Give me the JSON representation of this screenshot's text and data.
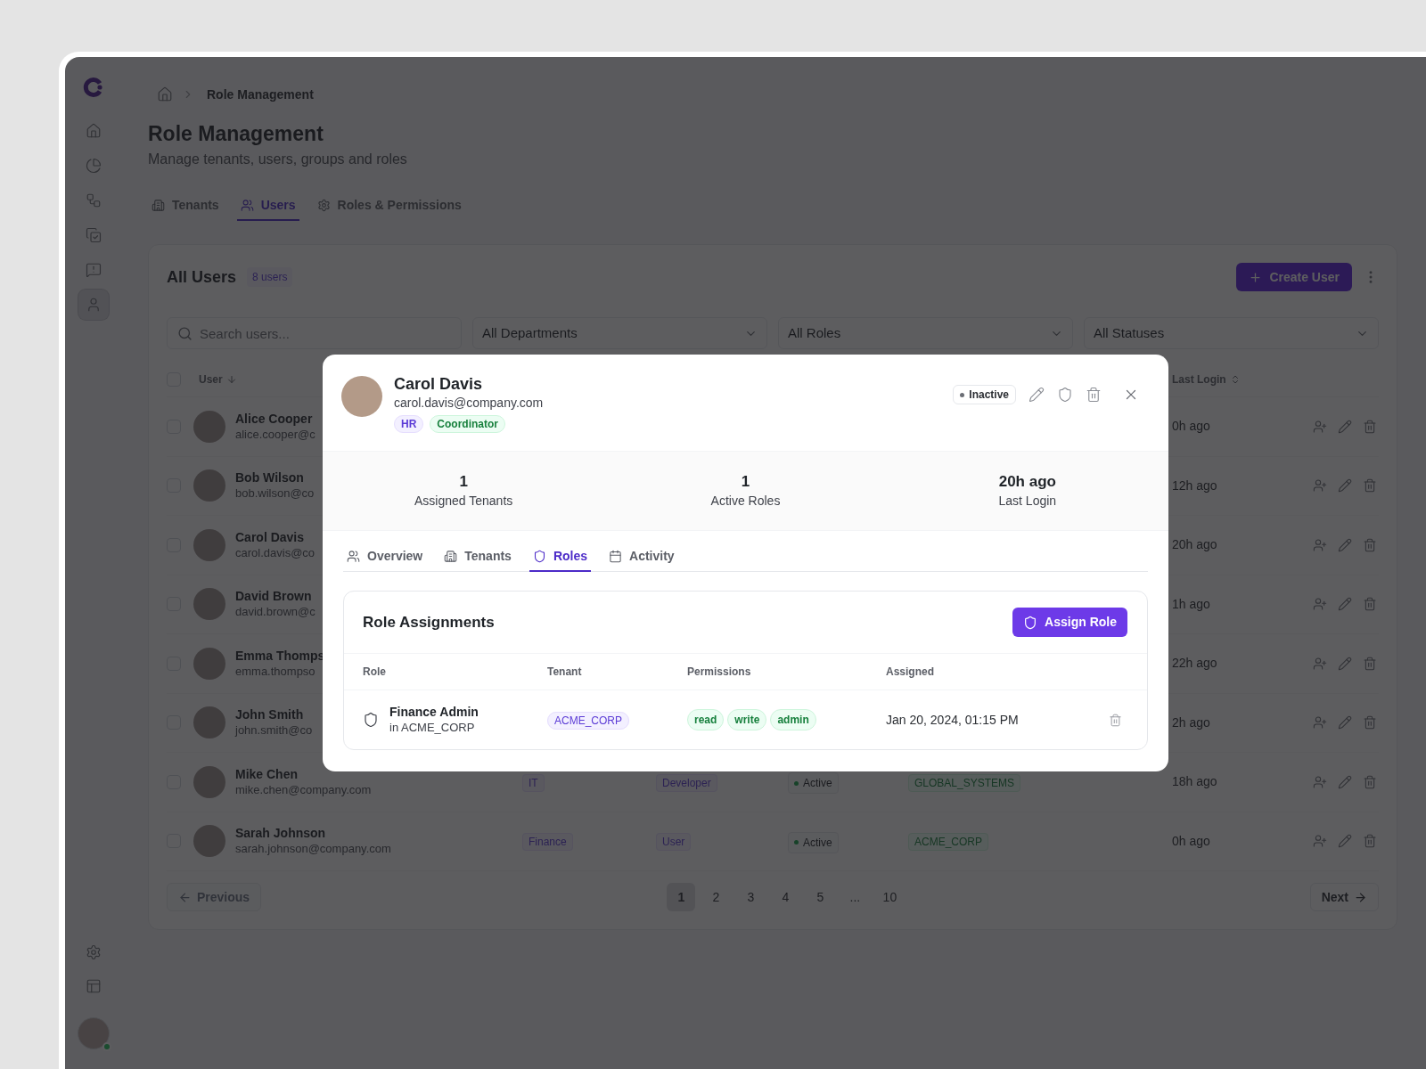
{
  "sidebar": {
    "items": [
      {
        "selected": false
      },
      {
        "selected": false
      },
      {
        "selected": false
      },
      {
        "selected": false
      },
      {
        "selected": false
      },
      {
        "selected": true
      }
    ],
    "profile": {
      "online": true
    }
  },
  "breadcrumb": {
    "current": "Role Management"
  },
  "page": {
    "title": "Role Management",
    "subtitle": "Manage tenants, users, groups and roles"
  },
  "tabs": [
    {
      "label": "Tenants",
      "selected": false
    },
    {
      "label": "Users",
      "selected": true
    },
    {
      "label": "Roles & Permissions",
      "selected": false
    }
  ],
  "users_card": {
    "title": "All Users",
    "count": "8 users",
    "create_button": "Create User",
    "search": {
      "placeholder": "Search users..."
    },
    "filters": [
      "All Departments",
      "All Roles",
      "All Statuses"
    ],
    "select_all": {
      "checked": false
    },
    "columns": [
      "User",
      "Last Login"
    ],
    "rows": [
      {
        "name": "Alice Cooper",
        "email": "alice.cooper@c",
        "last_login": "0h ago",
        "checked": false
      },
      {
        "name": "Bob Wilson",
        "email": "bob.wilson@co",
        "last_login": "12h ago",
        "checked": false
      },
      {
        "name": "Carol Davis",
        "email": "carol.davis@co",
        "last_login": "20h ago",
        "checked": false
      },
      {
        "name": "David Brown",
        "email": "david.brown@c",
        "last_login": "1h ago",
        "checked": false
      },
      {
        "name": "Emma Thomps",
        "email": "emma.thompso",
        "last_login": "22h ago",
        "checked": false
      },
      {
        "name": "John Smith",
        "email": "john.smith@co",
        "last_login": "2h ago",
        "checked": false
      },
      {
        "name": "Mike Chen",
        "email": "mike.chen@company.com",
        "department": "IT",
        "role": "Developer",
        "status": "Active",
        "tenant": "GLOBAL_SYSTEMS",
        "last_login": "18h ago",
        "checked": false
      },
      {
        "name": "Sarah Johnson",
        "email": "sarah.johnson@company.com",
        "department": "Finance",
        "role": "User",
        "status": "Active",
        "tenant": "ACME_CORP",
        "last_login": "0h ago",
        "checked": false
      }
    ],
    "pagination": {
      "previous": {
        "label": "Previous",
        "disabled": true
      },
      "next": {
        "label": "Next",
        "disabled": false
      },
      "pages": [
        {
          "label": "1",
          "selected": true
        },
        {
          "label": "2",
          "selected": false
        },
        {
          "label": "3",
          "selected": false
        },
        {
          "label": "4",
          "selected": false
        },
        {
          "label": "5",
          "selected": false
        },
        {
          "label": "...",
          "selected": false
        },
        {
          "label": "10",
          "selected": false
        }
      ]
    }
  },
  "modal": {
    "user": {
      "name": "Carol Davis",
      "email": "carol.davis@company.com",
      "tags": [
        {
          "label": "HR",
          "kind": "department"
        },
        {
          "label": "Coordinator",
          "kind": "role"
        }
      ],
      "status": "Inactive",
      "active": false
    },
    "stats": [
      {
        "value": "1",
        "label": "Assigned Tenants"
      },
      {
        "value": "1",
        "label": "Active Roles"
      },
      {
        "value": "20h ago",
        "label": "Last Login"
      }
    ],
    "tabs": [
      {
        "label": "Overview",
        "selected": false
      },
      {
        "label": "Tenants",
        "selected": false
      },
      {
        "label": "Roles",
        "selected": true
      },
      {
        "label": "Activity",
        "selected": false
      }
    ],
    "role_assignments": {
      "title": "Role Assignments",
      "assign_button": "Assign Role",
      "columns": [
        "Role",
        "Tenant",
        "Permissions",
        "Assigned"
      ],
      "rows": [
        {
          "role": "Finance Admin",
          "scope": "in ACME_CORP",
          "tenant": "ACME_CORP",
          "permissions": [
            "read",
            "write",
            "admin"
          ],
          "assigned": "Jan 20, 2024, 01:15 PM"
        }
      ]
    }
  }
}
